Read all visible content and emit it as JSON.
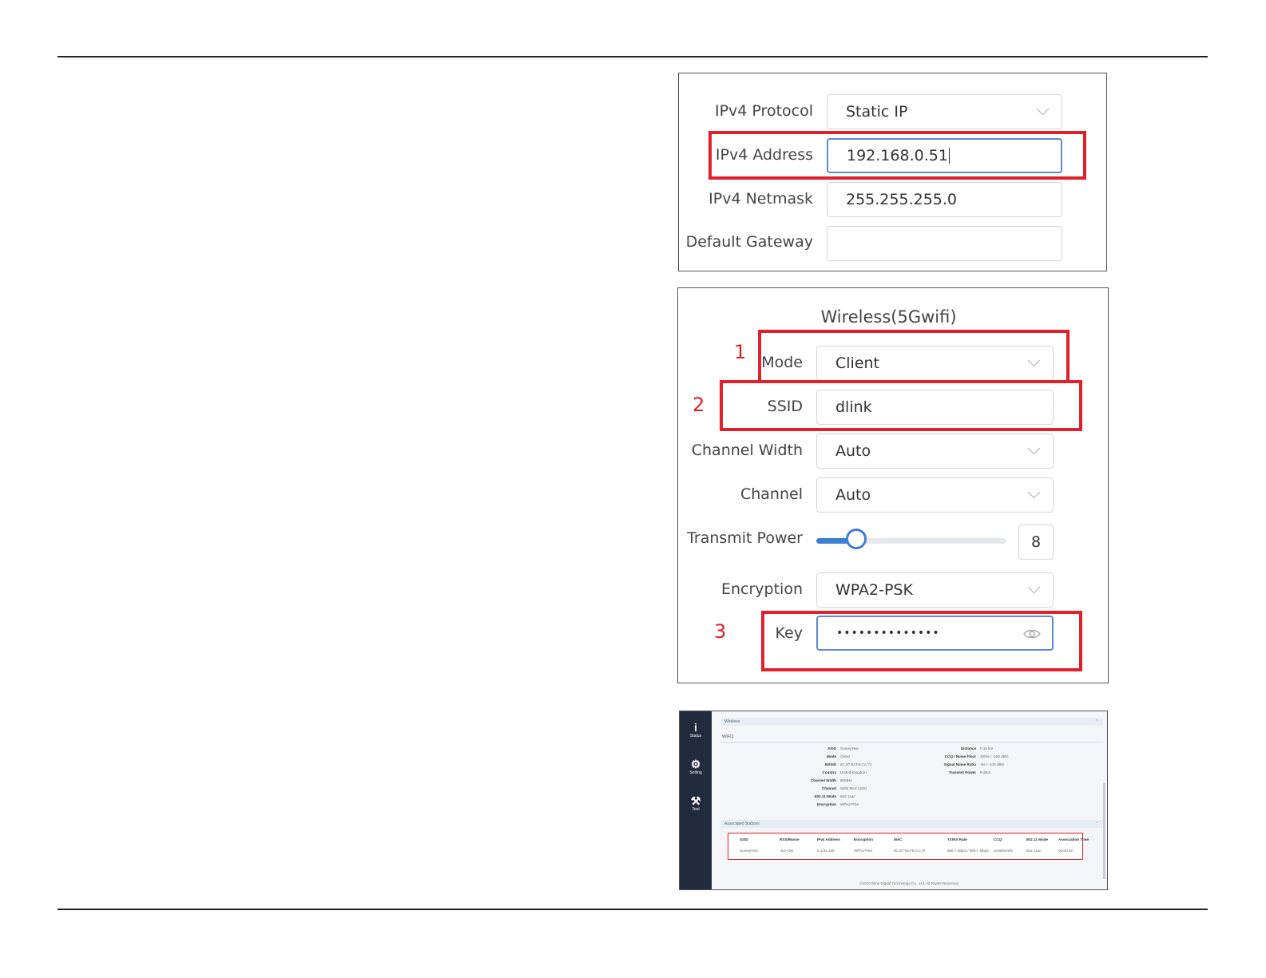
{
  "ip_panel": {
    "protocol_label": "IPv4 Protocol",
    "protocol_value": "Static IP",
    "address_label": "IPv4 Address",
    "address_value": "192.168.0.51",
    "netmask_label": "IPv4 Netmask",
    "netmask_value": "255.255.255.0",
    "gateway_label": "Default Gateway",
    "gateway_value": ""
  },
  "wireless_panel": {
    "title": "Wireless(5Gwifi)",
    "mode_label": "Mode",
    "mode_value": "Client",
    "ssid_label": "SSID",
    "ssid_value": "dlink",
    "channel_width_label": "Channel Width",
    "channel_width_value": "Auto",
    "channel_label": "Channel",
    "channel_value": "Auto",
    "transmit_power_label": "Transmit Power",
    "transmit_power_value": "8",
    "transmit_power_level": 0.21,
    "encryption_label": "Encryption",
    "encryption_value": "WPA2-PSK",
    "key_label": "Key",
    "key_value": "••••••••••••••",
    "callouts": [
      "1",
      "2",
      "3"
    ]
  },
  "status_screenshot": {
    "nav": [
      {
        "label": "Status",
        "icon": "info-icon"
      },
      {
        "label": "Setting",
        "icon": "gear-icon"
      },
      {
        "label": "Tool",
        "icon": "tools-icon"
      }
    ],
    "wireless_header": "Wireless",
    "wifi_name": "WIFI1",
    "left_fields": [
      {
        "k": "SSID",
        "v": "SurveyTest"
      },
      {
        "k": "Mode",
        "v": "Client"
      },
      {
        "k": "BSSID",
        "v": "8C:87:93:F5:CA:72"
      },
      {
        "k": "Country",
        "v": "United Kingdom"
      },
      {
        "k": "Channel Width",
        "v": "80MHz"
      },
      {
        "k": "Channel",
        "v": "5500 MHz (100)"
      },
      {
        "k": "802.11 Mode",
        "v": "802.11ac"
      },
      {
        "k": "Encryption",
        "v": "WPA2-PSK"
      }
    ],
    "right_fields": [
      {
        "k": "Distance",
        "v": "0.15 km"
      },
      {
        "k": "CCQ / Noise Floor",
        "v": "100% / -100 dBm"
      },
      {
        "k": "Signal Noise Ratio",
        "v": "-52 / -100 dBm"
      },
      {
        "k": "Transmit Power",
        "v": "8 dBm"
      }
    ],
    "stations_header": "Associated Stations",
    "table_headers": [
      "SSID",
      "RSSI/Noise",
      "IPv4 Address",
      "Encryption",
      "MAC",
      "TX/RX Rate",
      "CCQ",
      "802.11 Mode",
      "Association Time"
    ],
    "table_row": [
      "SurveyTest",
      "-52/-100",
      "0.1.84.136",
      "WPA2-PSK",
      "8C:87:93:F5:CA:72",
      "866.7 Mbps / 866.7 Mbps",
      "undefined%",
      "802.11ac",
      "00:00:32"
    ],
    "footer": "©2020 Dlink Digital Technology Co., Ltd. All Rights Reserved."
  },
  "colors": {
    "callout": "#e0202a",
    "focus": "#5b8bd4",
    "sidebar": "#222b3c"
  }
}
